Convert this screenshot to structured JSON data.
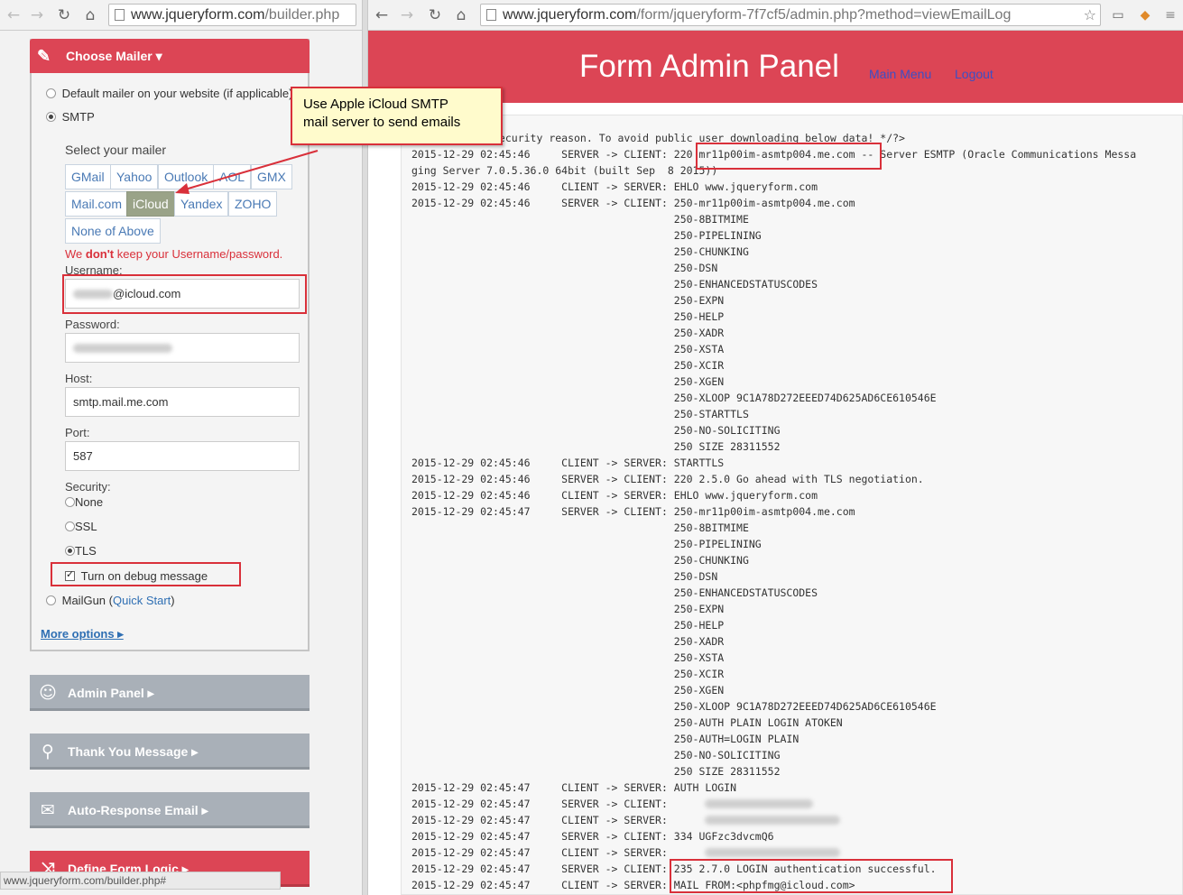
{
  "left_browser": {
    "url_main": "www.jqueryform.com",
    "url_path": "/builder.php",
    "status_url": "www.jqueryform.com/builder.php#"
  },
  "right_browser": {
    "url_main": "www.jqueryform.com",
    "url_path": "/form/jqueryform-7f7cf5/admin.php?method=viewEmailLog"
  },
  "mailer": {
    "title": "Choose Mailer ▾",
    "option_default": "Default mailer on your website (if applicable)",
    "option_smtp": "SMTP",
    "select_label": "Select your mailer",
    "buttons": [
      "GMail",
      "Yahoo",
      "Outlook",
      "AOL",
      "GMX",
      "Mail.com",
      "iCloud",
      "Yandex",
      "ZOHO",
      "None of Above"
    ],
    "active_button": "iCloud",
    "warning_prefix": "We ",
    "warning_bold": "don't",
    "warning_suffix": " keep your Username/password.",
    "username_label": "Username:",
    "username_value": "@icloud.com",
    "password_label": "Password:",
    "host_label": "Host:",
    "host_value": "smtp.mail.me.com",
    "port_label": "Port:",
    "port_value": "587",
    "security_label": "Security:",
    "security_options": [
      "None",
      "SSL",
      "TLS"
    ],
    "security_selected": "TLS",
    "debug_label": "Turn on debug message",
    "mailgun_label": "MailGun (",
    "mailgun_link": "Quick Start",
    "mailgun_close": ")",
    "more_options": "More options ▸"
  },
  "sections": [
    {
      "label": "Admin Panel ▸",
      "icon": "users-icon"
    },
    {
      "label": "Thank You Message ▸",
      "icon": "pin-icon"
    },
    {
      "label": "Auto-Response Email ▸",
      "icon": "envelope-icon"
    },
    {
      "label": "Define Form Logic ▸",
      "icon": "shuffle-icon"
    }
  ],
  "callout": {
    "line1": "Use Apple iCloud SMTP",
    "line2": "mail server to send emails"
  },
  "admin": {
    "title": "Form Admin Panel",
    "main_menu": "Main Menu",
    "logout": "Logout"
  },
  "log_lines": [
    "<?php /* For security reason. To avoid public user downloading below data! */?>",
    "2015-12-29 02:45:46     SERVER -> CLIENT: 220 mr11p00im-asmtp004.me.com -- Server ESMTP (Oracle Communications Messa",
    "ging Server 7.0.5.36.0 64bit (built Sep  8 2015))",
    "2015-12-29 02:45:46     CLIENT -> SERVER: EHLO www.jqueryform.com",
    "2015-12-29 02:45:46     SERVER -> CLIENT: 250-mr11p00im-asmtp004.me.com",
    "                                          250-8BITMIME",
    "                                          250-PIPELINING",
    "                                          250-CHUNKING",
    "                                          250-DSN",
    "                                          250-ENHANCEDSTATUSCODES",
    "                                          250-EXPN",
    "                                          250-HELP",
    "                                          250-XADR",
    "                                          250-XSTA",
    "                                          250-XCIR",
    "                                          250-XGEN",
    "                                          250-XLOOP 9C1A78D272EEED74D625AD6CE610546E",
    "                                          250-STARTTLS",
    "                                          250-NO-SOLICITING",
    "                                          250 SIZE 28311552",
    "2015-12-29 02:45:46     CLIENT -> SERVER: STARTTLS",
    "2015-12-29 02:45:46     SERVER -> CLIENT: 220 2.5.0 Go ahead with TLS negotiation.",
    "2015-12-29 02:45:46     CLIENT -> SERVER: EHLO www.jqueryform.com",
    "2015-12-29 02:45:47     SERVER -> CLIENT: 250-mr11p00im-asmtp004.me.com",
    "                                          250-8BITMIME",
    "                                          250-PIPELINING",
    "                                          250-CHUNKING",
    "                                          250-DSN",
    "                                          250-ENHANCEDSTATUSCODES",
    "                                          250-EXPN",
    "                                          250-HELP",
    "                                          250-XADR",
    "                                          250-XSTA",
    "                                          250-XCIR",
    "                                          250-XGEN",
    "                                          250-XLOOP 9C1A78D272EEED74D625AD6CE610546E",
    "                                          250-AUTH PLAIN LOGIN ATOKEN",
    "                                          250-AUTH=LOGIN PLAIN",
    "                                          250-NO-SOLICITING",
    "                                          250 SIZE 28311552",
    "2015-12-29 02:45:47     CLIENT -> SERVER: AUTH LOGIN",
    "2015-12-29 02:45:47     SERVER -> CLIENT:",
    "2015-12-29 02:45:47     CLIENT -> SERVER:",
    "2015-12-29 02:45:47     SERVER -> CLIENT: 334 UGFzc3dvcmQ6",
    "2015-12-29 02:45:47     CLIENT -> SERVER:",
    "2015-12-29 02:45:47     SERVER -> CLIENT: 235 2.7.0 LOGIN authentication successful.",
    "2015-12-29 02:45:47     CLIENT -> SERVER: MAIL FROM:<phpfmg@icloud.com>"
  ]
}
